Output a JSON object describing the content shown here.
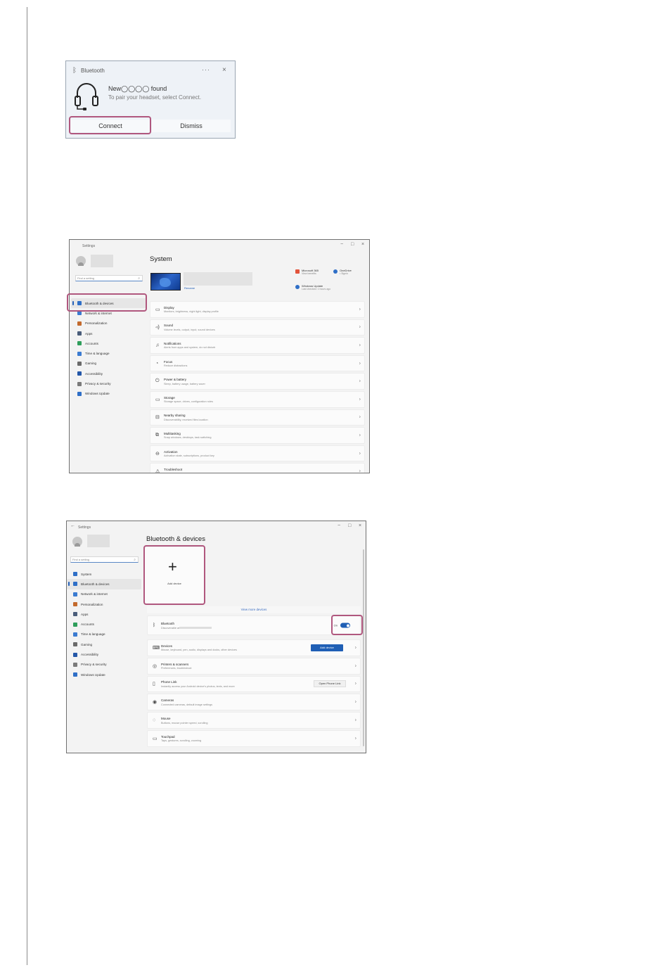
{
  "notification": {
    "app_name": "Bluetooth",
    "more": "···",
    "close": "×",
    "message_title": "New◯◯◯◯ found",
    "message_body": "To pair your headset, select Connect.",
    "connect_label": "Connect",
    "dismiss_label": "Dismiss"
  },
  "system_window": {
    "window_title": "Settings",
    "controls": [
      "−",
      "□",
      "×"
    ],
    "search_placeholder": "Find a setting",
    "page_title": "System",
    "rename": "Rename",
    "tiles": [
      {
        "title": "Microsoft 365",
        "sub": "View benefits"
      },
      {
        "title": "OneDrive",
        "sub": "• Signin"
      },
      {
        "title": "Windows Update",
        "sub": "Last checked: 1 hours ago"
      }
    ],
    "nav": [
      {
        "label": "Bluetooth & devices",
        "color": "#2f6fc7"
      },
      {
        "label": "Network & internet",
        "color": "#3b7bd1"
      },
      {
        "label": "Personalization",
        "color": "#c36a2d"
      },
      {
        "label": "Apps",
        "color": "#4a5d7a"
      },
      {
        "label": "Accounts",
        "color": "#2f9e5b"
      },
      {
        "label": "Time & language",
        "color": "#3b7bd1"
      },
      {
        "label": "Gaming",
        "color": "#6a6a6a"
      },
      {
        "label": "Accessibility",
        "color": "#2457a8"
      },
      {
        "label": "Privacy & security",
        "color": "#7a7a7a"
      },
      {
        "label": "Windows Update",
        "color": "#2f6fc7"
      }
    ],
    "cards": [
      {
        "icon": "▭",
        "title": "Display",
        "sub": "Monitors, brightness, night light, display profile"
      },
      {
        "icon": "◃)",
        "title": "Sound",
        "sub": "Volume levels, output, input, sound devices"
      },
      {
        "icon": "♫",
        "title": "Notifications",
        "sub": "Alerts from apps and system, do not disturb"
      },
      {
        "icon": "◔",
        "title": "Focus",
        "sub": "Reduce distractions"
      },
      {
        "icon": "⏻",
        "title": "Power & battery",
        "sub": "Sleep, battery usage, battery saver"
      },
      {
        "icon": "▭",
        "title": "Storage",
        "sub": "Storage space, drives, configuration rules"
      },
      {
        "icon": "⊟",
        "title": "Nearby sharing",
        "sub": "Discoverability, received files location"
      },
      {
        "icon": "⧉",
        "title": "Multitasking",
        "sub": "Snap windows, desktops, task switching"
      },
      {
        "icon": "⊖",
        "title": "Activation",
        "sub": "Activation state, subscriptions, product key"
      },
      {
        "icon": "⚠",
        "title": "Troubleshoot",
        "sub": ""
      }
    ]
  },
  "bt_window": {
    "window_title": "Settings",
    "controls": [
      "−",
      "□",
      "×"
    ],
    "back": "←",
    "search_placeholder": "Find a setting",
    "page_title": "Bluetooth & devices",
    "add_device_tile": "Add device",
    "view_more": "View more devices",
    "bluetooth_title": "Bluetooth",
    "bluetooth_sub": "Discoverable as",
    "bluetooth_state": "On",
    "nav": [
      {
        "label": "System",
        "color": "#2f6fc7"
      },
      {
        "label": "Bluetooth & devices",
        "color": "#2f6fc7"
      },
      {
        "label": "Network & internet",
        "color": "#3b7bd1"
      },
      {
        "label": "Personalization",
        "color": "#c36a2d"
      },
      {
        "label": "Apps",
        "color": "#4a5d7a"
      },
      {
        "label": "Accounts",
        "color": "#2f9e5b"
      },
      {
        "label": "Time & language",
        "color": "#3b7bd1"
      },
      {
        "label": "Gaming",
        "color": "#6a6a6a"
      },
      {
        "label": "Accessibility",
        "color": "#2457a8"
      },
      {
        "label": "Privacy & security",
        "color": "#7a7a7a"
      },
      {
        "label": "Windows Update",
        "color": "#2f6fc7"
      }
    ],
    "cards": [
      {
        "icon": "⌨",
        "title": "Devices",
        "sub": "Mouse, keyboard, pen, audio, displays and docks, other devices",
        "button": "Add device"
      },
      {
        "icon": "◎",
        "title": "Printers & scanners",
        "sub": "Preferences, troubleshoot",
        "button": ""
      },
      {
        "icon": "▯",
        "title": "Phone Link",
        "sub": "Instantly access your Android device's photos, texts, and more",
        "button": "Open Phone Link"
      },
      {
        "icon": "◉",
        "title": "Cameras",
        "sub": "Connected cameras, default image settings",
        "button": ""
      },
      {
        "icon": "◌",
        "title": "Mouse",
        "sub": "Buttons, mouse pointer speed, scrolling",
        "button": ""
      },
      {
        "icon": "▭",
        "title": "Touchpad",
        "sub": "Taps, gestures, scrolling, zooming",
        "button": ""
      }
    ]
  }
}
